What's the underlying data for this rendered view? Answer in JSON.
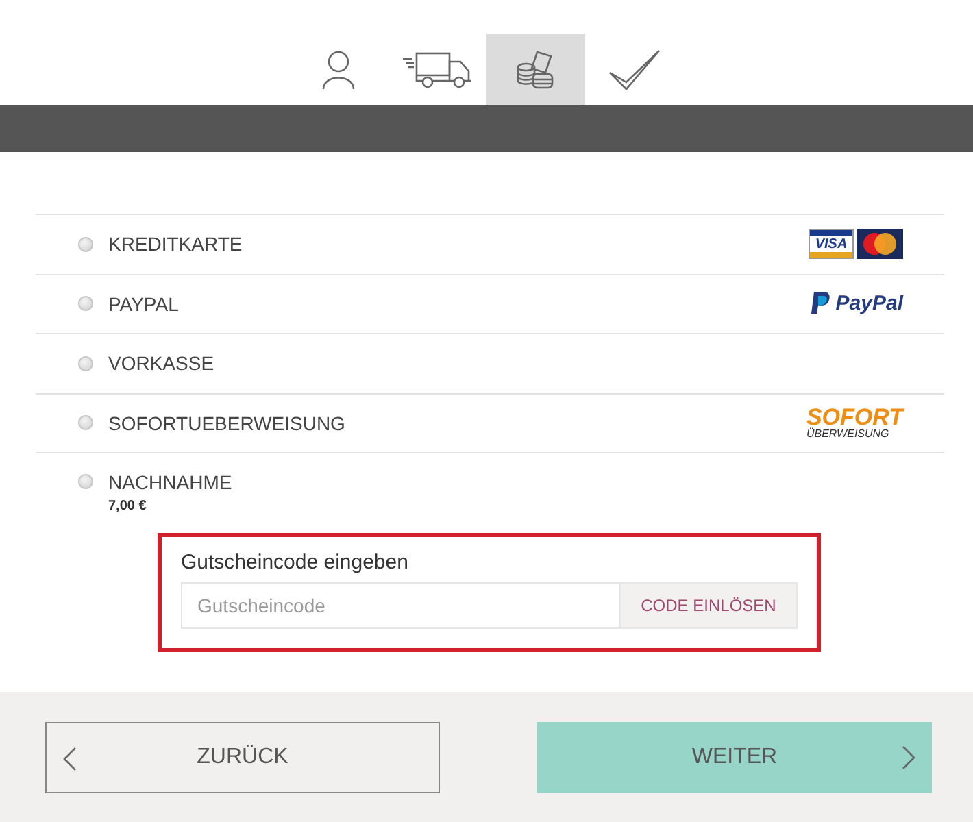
{
  "steps": [
    {
      "kind": "person",
      "selected": false
    },
    {
      "kind": "truck",
      "selected": false
    },
    {
      "kind": "coins",
      "selected": true
    },
    {
      "kind": "check",
      "selected": false
    }
  ],
  "payment_options": [
    {
      "label": "KREDITKARTE",
      "selected": false,
      "logo": {
        "kind": "cards",
        "texts": [
          "VISA"
        ]
      }
    },
    {
      "label": "PAYPAL",
      "selected": false,
      "logo": {
        "kind": "paypal",
        "texts": [
          "PayPal"
        ]
      }
    },
    {
      "label": "VORKASSE",
      "selected": false
    },
    {
      "label": "SOFORTUEBERWEISUNG",
      "selected": false,
      "logo": {
        "kind": "sofort",
        "texts": [
          "SOFORT",
          "ÜBERWEISUNG"
        ]
      }
    },
    {
      "label": "NACHNAHME",
      "selected": false,
      "fee": "7,00 €"
    }
  ],
  "voucher": {
    "title": "Gutscheincode eingeben",
    "placeholder": "Gutscheincode",
    "button": "CODE EINLÖSEN"
  },
  "footer": {
    "back": "ZURÜCK",
    "next": "WEITER"
  }
}
